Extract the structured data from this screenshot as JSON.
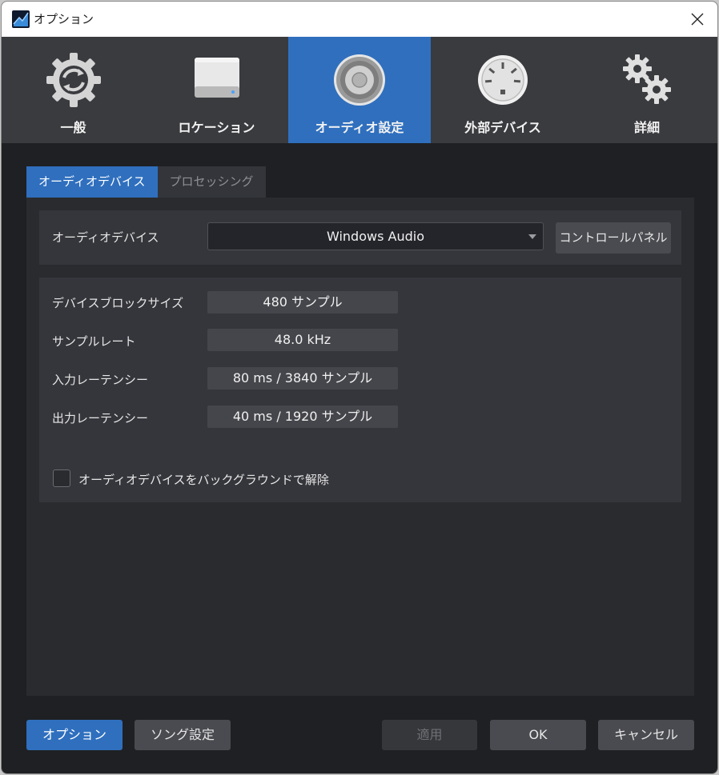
{
  "window": {
    "title": "オプション"
  },
  "categories": [
    {
      "label": "一般",
      "icon": "sync-gear-icon",
      "active": false
    },
    {
      "label": "ロケーション",
      "icon": "hard-drive-icon",
      "active": false
    },
    {
      "label": "オーディオ設定",
      "icon": "speaker-icon",
      "active": true
    },
    {
      "label": "外部デバイス",
      "icon": "midi-connector-icon",
      "active": false
    },
    {
      "label": "詳細",
      "icon": "gears-icon",
      "active": false
    }
  ],
  "subtabs": [
    {
      "label": "オーディオデバイス",
      "active": true
    },
    {
      "label": "プロセッシング",
      "active": false
    }
  ],
  "device": {
    "label": "オーディオデバイス",
    "value": "Windows Audio",
    "control_panel_label": "コントロールパネル"
  },
  "info": {
    "block_size_label": "デバイスブロックサイズ",
    "block_size_value": "480 サンプル",
    "sample_rate_label": "サンプルレート",
    "sample_rate_value": "48.0 kHz",
    "input_latency_label": "入力レーテンシー",
    "input_latency_value": "80 ms / 3840 サンプル",
    "output_latency_label": "出力レーテンシー",
    "output_latency_value": "40 ms / 1920 サンプル",
    "background_release_label": "オーディオデバイスをバックグラウンドで解除",
    "background_release_checked": false
  },
  "footer": {
    "options_label": "オプション",
    "song_settings_label": "ソング設定",
    "apply_label": "適用",
    "ok_label": "OK",
    "cancel_label": "キャンセル"
  },
  "colors": {
    "accent": "#2f6fbe",
    "background": "#1f2023",
    "panel": "#2a2b2f"
  }
}
